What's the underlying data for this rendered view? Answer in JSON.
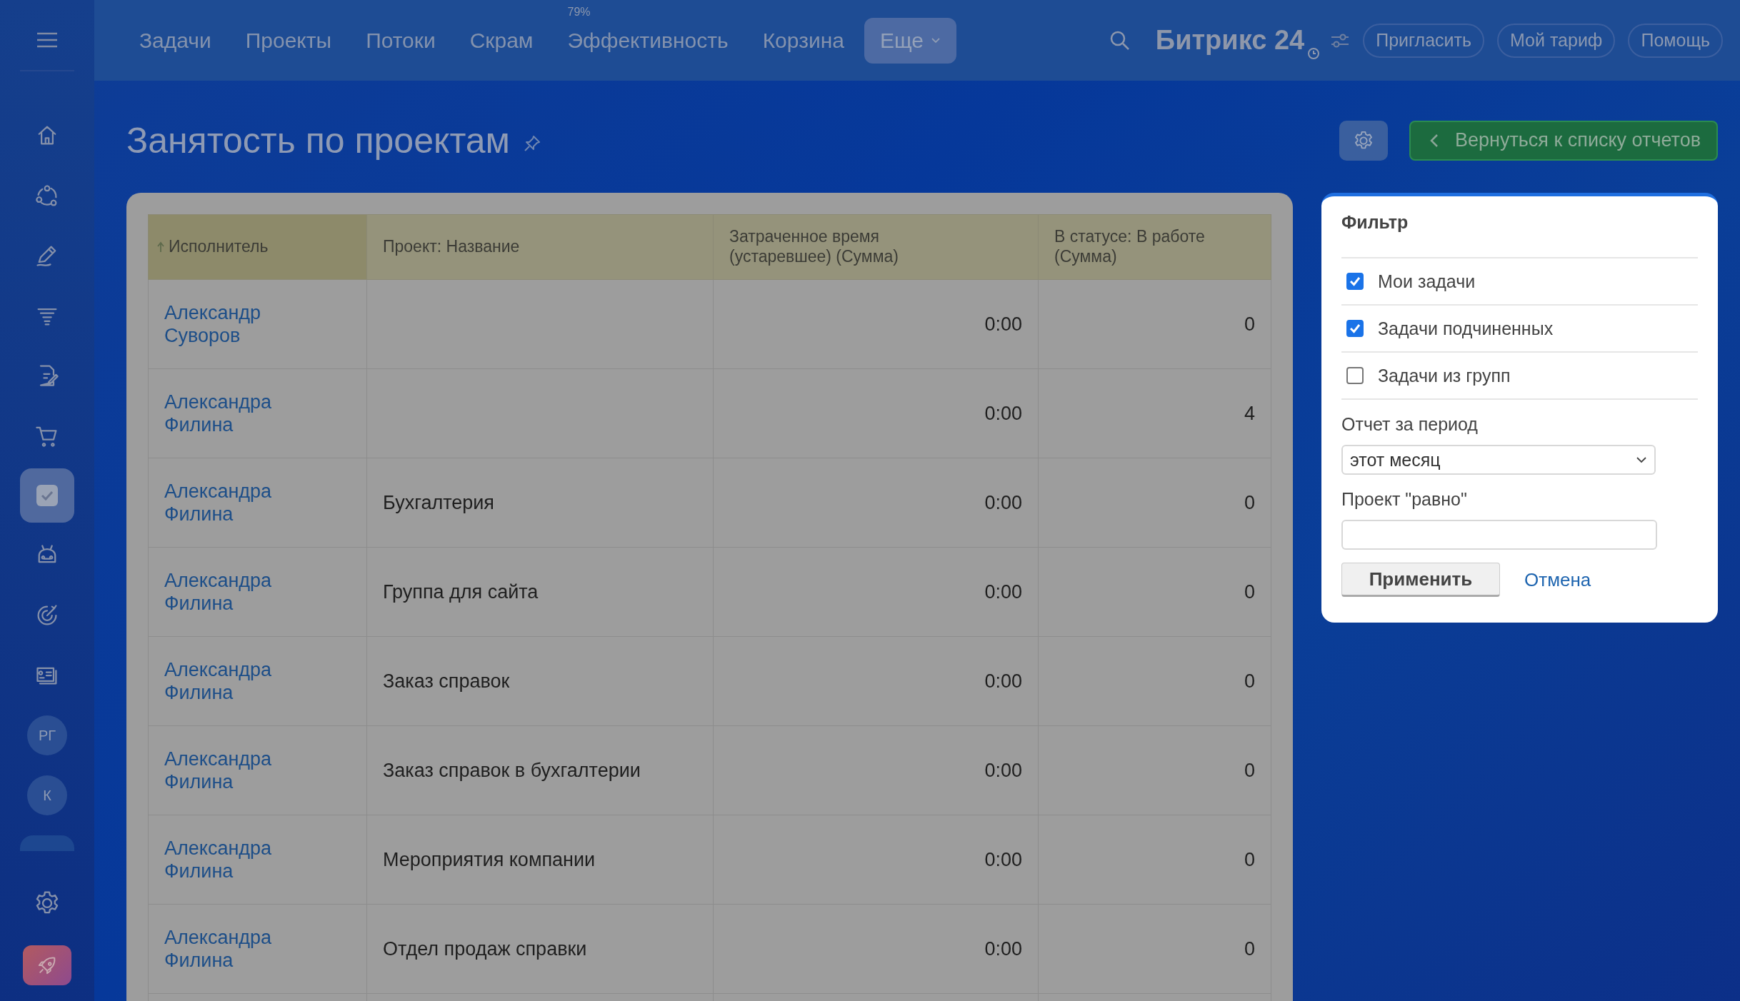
{
  "sidebar": {
    "items": [
      {
        "selected": false
      },
      {
        "selected": false
      },
      {
        "selected": false
      },
      {
        "selected": false
      },
      {
        "selected": false
      },
      {
        "selected": false
      },
      {
        "selected": true
      },
      {
        "selected": false
      },
      {
        "selected": false
      },
      {
        "selected": false
      }
    ],
    "avatars": [
      {
        "initials": "РГ"
      },
      {
        "initials": "К"
      }
    ]
  },
  "top_nav": {
    "items": [
      {
        "label": "Задачи"
      },
      {
        "label": "Проекты"
      },
      {
        "label": "Потоки"
      },
      {
        "label": "Скрам"
      },
      {
        "label": "Эффективность",
        "counter": "79%"
      },
      {
        "label": "Корзина"
      }
    ],
    "more": {
      "label": "Еще"
    }
  },
  "header": {
    "logo": "Битрикс 24",
    "buttons": [
      "Пригласить",
      "Мой тариф",
      "Помощь"
    ]
  },
  "page": {
    "title": "Занятость по проектам",
    "back_button": "Вернуться к списку отчетов"
  },
  "table": {
    "columns": [
      {
        "label": "Исполнитель",
        "sorted": true
      },
      {
        "label": "Проект: Название",
        "sorted": false
      },
      {
        "label": "Затраченное время (устаревшее) (Сумма)",
        "sorted": false
      },
      {
        "label": "В статусе: В работе (Сумма)",
        "sorted": false
      }
    ],
    "rows": [
      {
        "executor": "Александр Суворов",
        "project": "",
        "time": "0:00",
        "in_work": "0"
      },
      {
        "executor": "Александра Филина",
        "project": "",
        "time": "0:00",
        "in_work": "4"
      },
      {
        "executor": "Александра Филина",
        "project": "Бухгалтерия",
        "time": "0:00",
        "in_work": "0"
      },
      {
        "executor": "Александра Филина",
        "project": "Группа для сайта",
        "time": "0:00",
        "in_work": "0"
      },
      {
        "executor": "Александра Филина",
        "project": "Заказ справок",
        "time": "0:00",
        "in_work": "0"
      },
      {
        "executor": "Александра Филина",
        "project": "Заказ справок в бухгалтерии",
        "time": "0:00",
        "in_work": "0"
      },
      {
        "executor": "Александра Филина",
        "project": "Мероприятия компании",
        "time": "0:00",
        "in_work": "0"
      },
      {
        "executor": "Александра Филина",
        "project": "Отдел продаж справки",
        "time": "0:00",
        "in_work": "0"
      }
    ]
  },
  "filter": {
    "title": "Фильтр",
    "checkboxes": [
      {
        "label": "Мои задачи",
        "checked": true
      },
      {
        "label": "Задачи подчиненных",
        "checked": true
      },
      {
        "label": "Задачи из групп",
        "checked": false
      }
    ],
    "period_label": "Отчет за период",
    "period_value": "этот месяц",
    "project_label": "Проект \"равно\"",
    "apply": "Применить",
    "cancel": "Отмена"
  }
}
